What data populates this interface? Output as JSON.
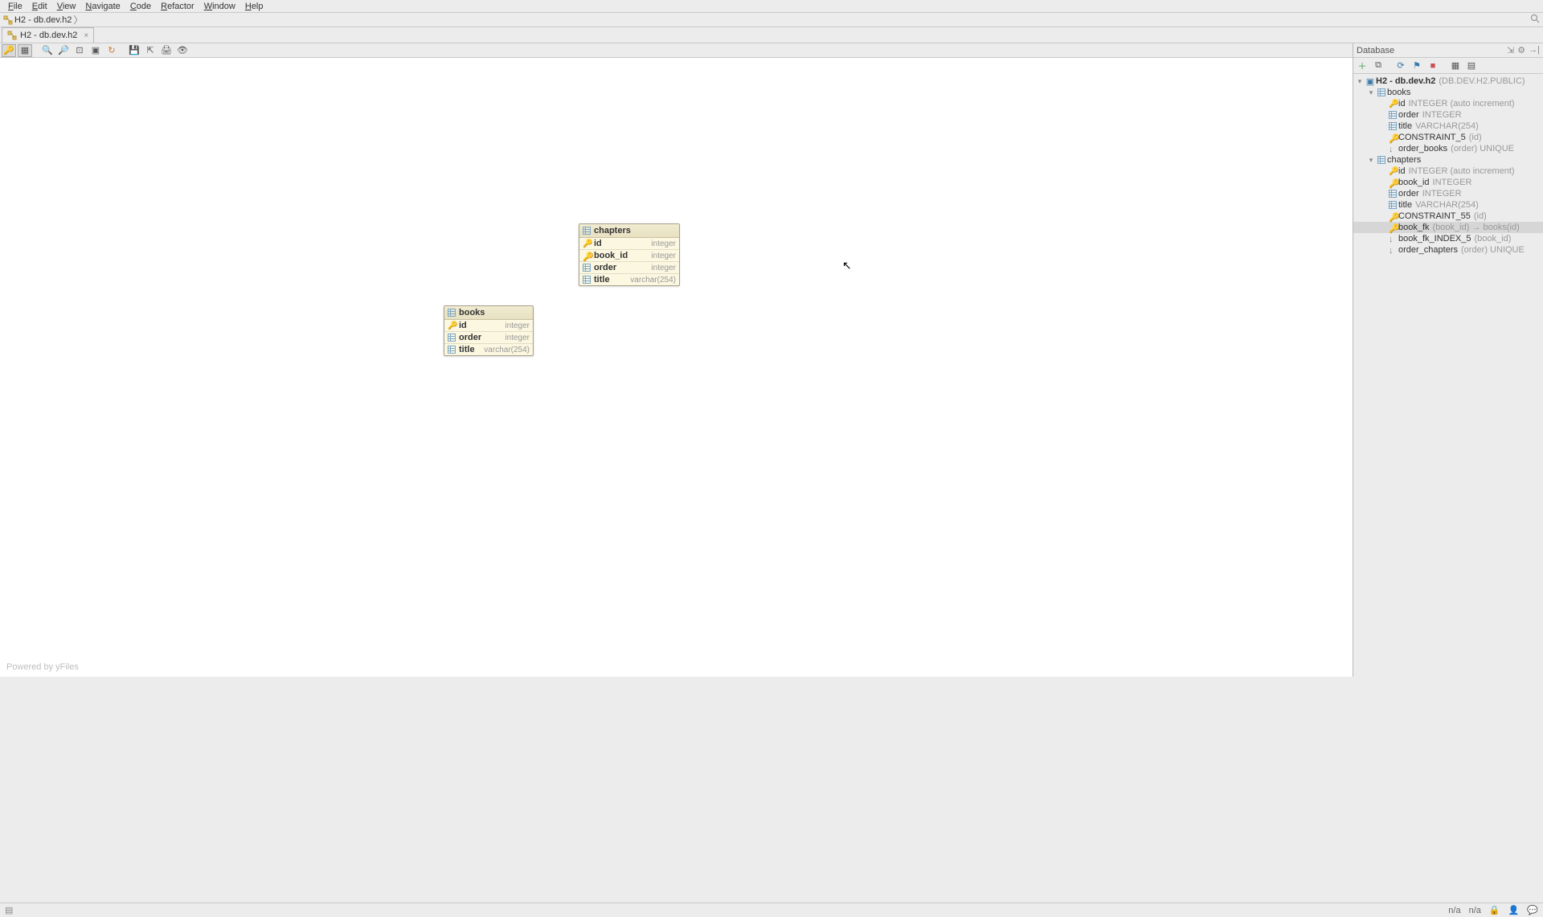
{
  "menu": {
    "items": [
      "File",
      "Edit",
      "View",
      "Navigate",
      "Code",
      "Refactor",
      "Window",
      "Help"
    ]
  },
  "breadcrumb": {
    "text": "H2 - db.dev.h2"
  },
  "tab": {
    "label": "H2 - db.dev.h2"
  },
  "diagram": {
    "powered": "Powered by yFiles",
    "entities": {
      "chapters": {
        "title": "chapters",
        "rows": [
          {
            "icon": "key",
            "name": "id",
            "type": "integer"
          },
          {
            "icon": "fk",
            "name": "book_id",
            "type": "integer"
          },
          {
            "icon": "col",
            "name": "order",
            "type": "integer"
          },
          {
            "icon": "col",
            "name": "title",
            "type": "varchar(254)"
          }
        ]
      },
      "books": {
        "title": "books",
        "rows": [
          {
            "icon": "key",
            "name": "id",
            "type": "integer"
          },
          {
            "icon": "col",
            "name": "order",
            "type": "integer"
          },
          {
            "icon": "col",
            "name": "title",
            "type": "varchar(254)"
          }
        ]
      }
    }
  },
  "dbpanel": {
    "title": "Database",
    "datasource": {
      "name": "H2 - db.dev.h2",
      "detail": "(DB.DEV.H2.PUBLIC)"
    },
    "tables": [
      {
        "name": "books",
        "items": [
          {
            "icon": "key",
            "name": "id",
            "detail": "INTEGER (auto increment)"
          },
          {
            "icon": "col",
            "name": "order",
            "detail": "INTEGER"
          },
          {
            "icon": "col",
            "name": "title",
            "detail": "VARCHAR(254)"
          },
          {
            "icon": "constraint",
            "name": "CONSTRAINT_5",
            "detail": "(id)"
          },
          {
            "icon": "index",
            "name": "order_books",
            "detail": "(order) UNIQUE"
          }
        ]
      },
      {
        "name": "chapters",
        "items": [
          {
            "icon": "key",
            "name": "id",
            "detail": "INTEGER (auto increment)"
          },
          {
            "icon": "fk",
            "name": "book_id",
            "detail": "INTEGER"
          },
          {
            "icon": "col",
            "name": "order",
            "detail": "INTEGER"
          },
          {
            "icon": "col",
            "name": "title",
            "detail": "VARCHAR(254)"
          },
          {
            "icon": "constraint",
            "name": "CONSTRAINT_55",
            "detail": "(id)"
          },
          {
            "icon": "fk-ref",
            "name": "book_fk",
            "detail": "(book_id) → books(id)",
            "selected": true
          },
          {
            "icon": "index",
            "name": "book_fk_INDEX_5",
            "detail": "(book_id)"
          },
          {
            "icon": "index",
            "name": "order_chapters",
            "detail": "(order) UNIQUE"
          }
        ]
      }
    ]
  },
  "status": {
    "na1": "n/a",
    "na2": "n/a"
  }
}
